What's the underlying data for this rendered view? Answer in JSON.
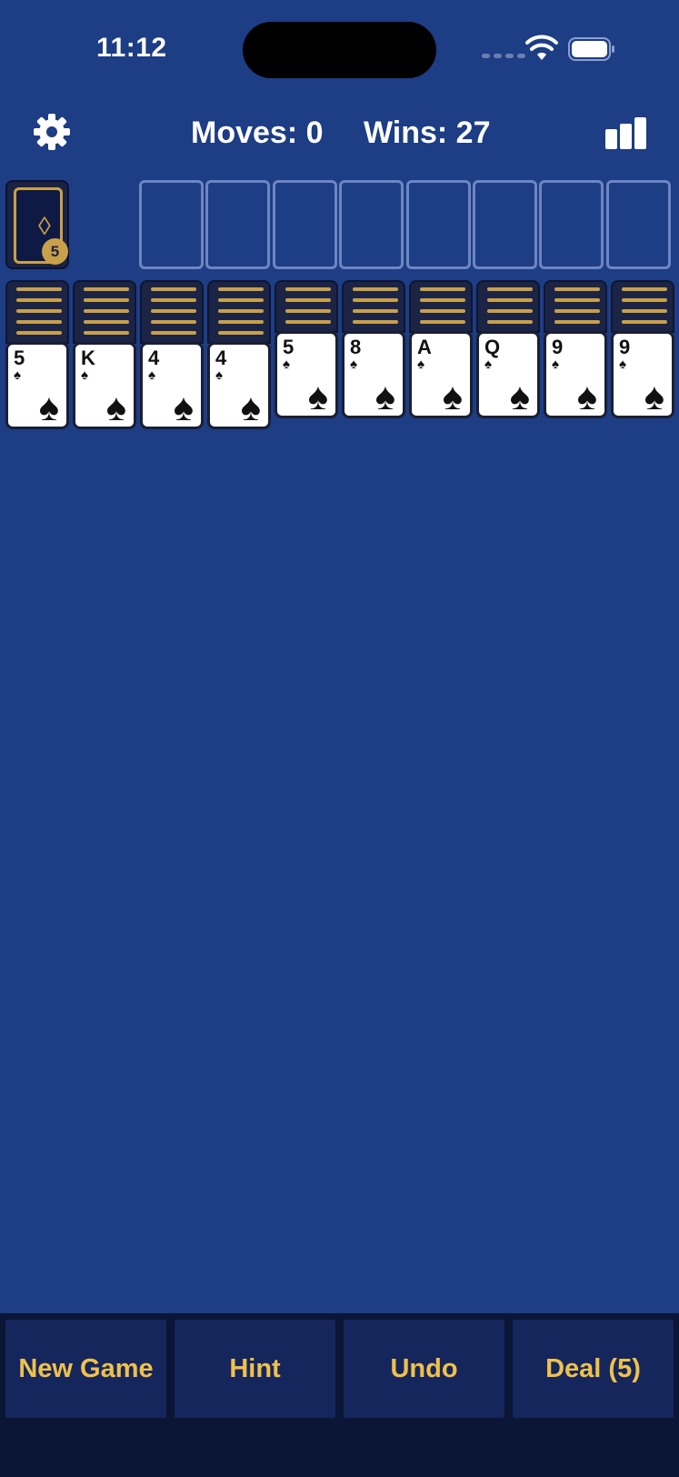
{
  "status": {
    "time": "11:12"
  },
  "header": {
    "moves": "Moves: 0",
    "wins": "Wins: 27"
  },
  "stock": {
    "symbol": "◊",
    "count": "5"
  },
  "columns": [
    {
      "rank": "5",
      "suit": "♠"
    },
    {
      "rank": "K",
      "suit": "♠"
    },
    {
      "rank": "4",
      "suit": "♠"
    },
    {
      "rank": "4",
      "suit": "♠"
    },
    {
      "rank": "5",
      "suit": "♠"
    },
    {
      "rank": "8",
      "suit": "♠"
    },
    {
      "rank": "A",
      "suit": "♠"
    },
    {
      "rank": "Q",
      "suit": "♠"
    },
    {
      "rank": "9",
      "suit": "♠"
    },
    {
      "rank": "9",
      "suit": "♠"
    }
  ],
  "buttons": {
    "new_game": "New Game",
    "hint": "Hint",
    "undo": "Undo",
    "deal": "Deal (5)"
  },
  "colors": {
    "background": "#1d3d84",
    "accent_gold": "#c9a04a",
    "button_text": "#f0c14b"
  },
  "icons": {
    "settings": "gear-icon",
    "stats": "bar-chart-icon",
    "wifi": "wifi-icon",
    "battery": "battery-icon"
  }
}
